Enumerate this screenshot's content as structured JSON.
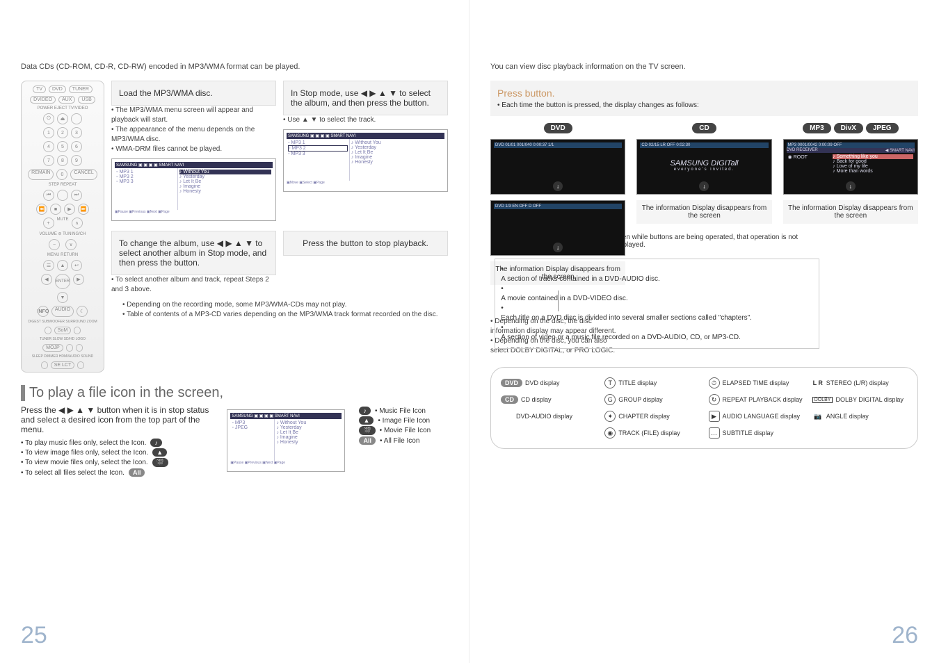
{
  "left": {
    "intro": "Data CDs (CD-ROM, CD-R, CD-RW) encoded in MP3/WMA format can be played.",
    "step1": {
      "text": "Load the MP3/WMA disc.",
      "notes": [
        "• The MP3/WMA menu screen will appear and playback will start.",
        "• The appearance of the menu depends on the MP3/WMA disc.",
        "• WMA-DRM files cannot be played."
      ]
    },
    "step2": {
      "text": "In Stop mode, use ◀ ▶ ▲ ▼ to select the album, and then press the         button.",
      "note": "• Use ▲ ▼ to select the track."
    },
    "step3": {
      "text": "To change the album, use ◀ ▶ ▲ ▼ to select another album in Stop mode, and then press the         button.",
      "note": "• To select another album and track, repeat Steps 2 and 3 above."
    },
    "step4": {
      "text": "Press the         button to stop playback."
    },
    "footnotes": [
      "• Depending on the recording mode, some MP3/WMA-CDs may not play.",
      "• Table of contents of a MP3-CD varies depending on the MP3/WMA track format recorded on the disc."
    ],
    "play_icon_section": {
      "title": "To play a file icon in the screen,",
      "lead": "Press the ◀ ▶ ▲ ▼ button when it is in stop status and select a desired icon from the top part of the menu.",
      "bullets": [
        "• To play music files only, select the        Icon.",
        "• To view image files only, select the        Icon.",
        "• To view movie files only, select the        Icon.",
        "• To select all files select the        Icon."
      ],
      "legend": [
        "• Music File Icon",
        "• Image File Icon",
        "• Movie File Icon",
        "• All File Icon"
      ]
    },
    "screen_sample": {
      "folders": [
        "MP3 1",
        "MP3 2",
        "MP3 3"
      ],
      "tracks": [
        "Without You",
        "Yesterday",
        "Let It Be",
        "Imagine",
        "Honesty"
      ],
      "selected": "Without You"
    },
    "screen_sample2": {
      "folders": [
        "MP3 1",
        "MP3 2",
        "MP3 3"
      ],
      "tracks": [
        "Without You",
        "Yesterday",
        "Let It Be",
        "Imagine",
        "Honesty"
      ],
      "selected": "MP3 2"
    },
    "screen_sample3": {
      "folders": [
        "MP3",
        "JPEG"
      ],
      "tracks": [
        "Without You",
        "Yesterday",
        "Let It Be",
        "Imagine",
        "Honesty"
      ]
    },
    "page_num": "25"
  },
  "right": {
    "intro": "You can view disc playback information  on the TV screen.",
    "press": {
      "title": "Press        button.",
      "sub": "• Each time the button is pressed, the display changes as follows:"
    },
    "cols": {
      "dvd": {
        "badge": "DVD",
        "bar1": "DVD  01/01  001/040  0:00:37  1/1",
        "bar2": "DVD  1/3  EN  OFF  D  OFF",
        "info": "The information Display disappears from the screen",
        "notes": [
          "• Depending on the disc, the disc information display may appear different.",
          "• Depending on the disc, you can also select DOLBY DIGITAL, or PRO LOGIC."
        ]
      },
      "cd": {
        "badge": "CD",
        "bar": "CD  02/15  LR  OFF  0:02:30",
        "brand": "SAMSUNG DIGITall",
        "tag": "everyone's invited.",
        "info": "The information Display disappears from the screen"
      },
      "mp3": {
        "badges": [
          "MP3",
          "DivX",
          "JPEG"
        ],
        "bar": "MP3  0001/0042  0:00:09  OFF",
        "receiver": "DVD RECEIVER",
        "nav": "SMART NAVI",
        "root": "ROOT",
        "tracks": [
          "Something like you",
          "Back for good",
          "Love of my life",
          "More than words"
        ],
        "info": "The information Display disappears from the screen"
      }
    },
    "hand_note": "If this symbol appears on the TV screen while buttons are being operated, that operation is not possible with the disc currently being played.",
    "defs": [
      "A section of tracks contained in a DVD-AUDIO disc.",
      "A movie contained in a DVD-VIDEO disc.",
      "Each title on a DVD disc is divided into several smaller sections called \"chapters\".",
      "A section of video or a music file recorded on a DVD-AUDIO, CD, or MP3-CD."
    ],
    "legend": {
      "dvd": "DVD display",
      "cd": "CD display",
      "dvda": "DVD-AUDIO display",
      "title": "TITLE display",
      "group": "GROUP display",
      "chapter": "CHAPTER display",
      "track": "TRACK (FILE) display",
      "elapsed": "ELAPSED TIME display",
      "repeat": "REPEAT PLAYBACK display",
      "audiolang": "AUDIO LANGUAGE display",
      "subtitle": "SUBTITLE display",
      "stereo": "STEREO (L/R) display",
      "dolby": "DOLBY DIGITAL display",
      "angle": "ANGLE display",
      "lr_label": "L R",
      "dolby_label": "DOLBY"
    },
    "page_num": "26"
  }
}
